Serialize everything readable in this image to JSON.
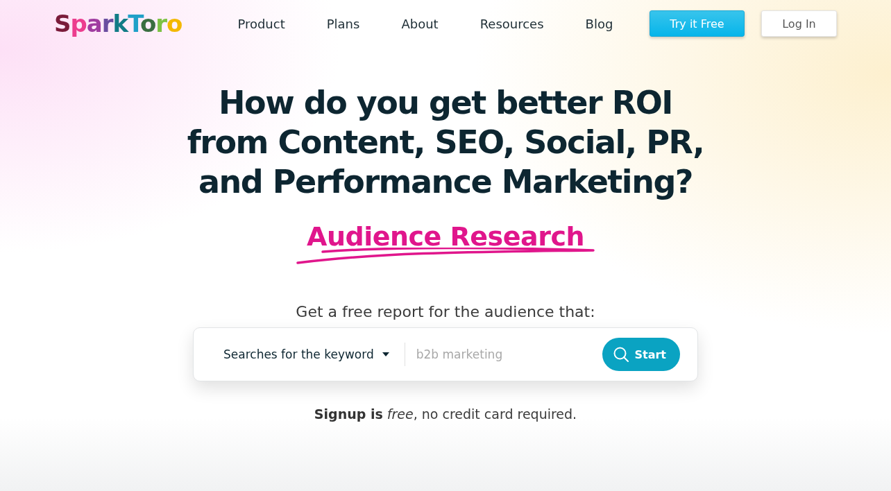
{
  "header": {
    "logo": "SparkToro",
    "nav": [
      {
        "label": "Product"
      },
      {
        "label": "Plans"
      },
      {
        "label": "About"
      },
      {
        "label": "Resources"
      },
      {
        "label": "Blog"
      }
    ],
    "buttons": [
      {
        "label": "Try it Free",
        "kind": "primary"
      },
      {
        "label": "Log In",
        "kind": "secondary"
      }
    ]
  },
  "hero": {
    "headline": "How do you get better ROI from Content, SEO, Social, PR, and Performance Marketing?",
    "highlight": "Audience Research"
  },
  "search": {
    "prompt": "Get a free report for the audience that:",
    "mode": "Searches for the keyword",
    "placeholder": "b2b marketing",
    "button": "Start"
  },
  "note": "**Signup is** *free*, no credit card required."
}
